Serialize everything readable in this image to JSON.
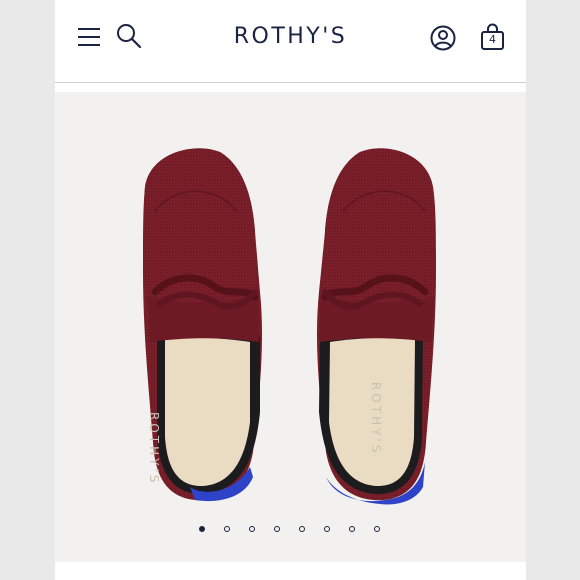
{
  "header": {
    "brand": "ROTHY'S",
    "bag_count": "4",
    "icons": [
      "menu-icon",
      "search-icon",
      "account-icon",
      "shopping-bag-icon"
    ]
  },
  "product": {
    "insole_brand": "ROTHY'S",
    "colors": {
      "knit": "#7b1f2a",
      "insole": "#e9dcc2",
      "lining": "#1c1c1f",
      "heel_accent": "#2e43c8"
    }
  },
  "carousel": {
    "total_slides": 8,
    "active_slide": 1
  },
  "colors": {
    "brand_navy": "#1b2342",
    "background": "#f2f1ef"
  }
}
